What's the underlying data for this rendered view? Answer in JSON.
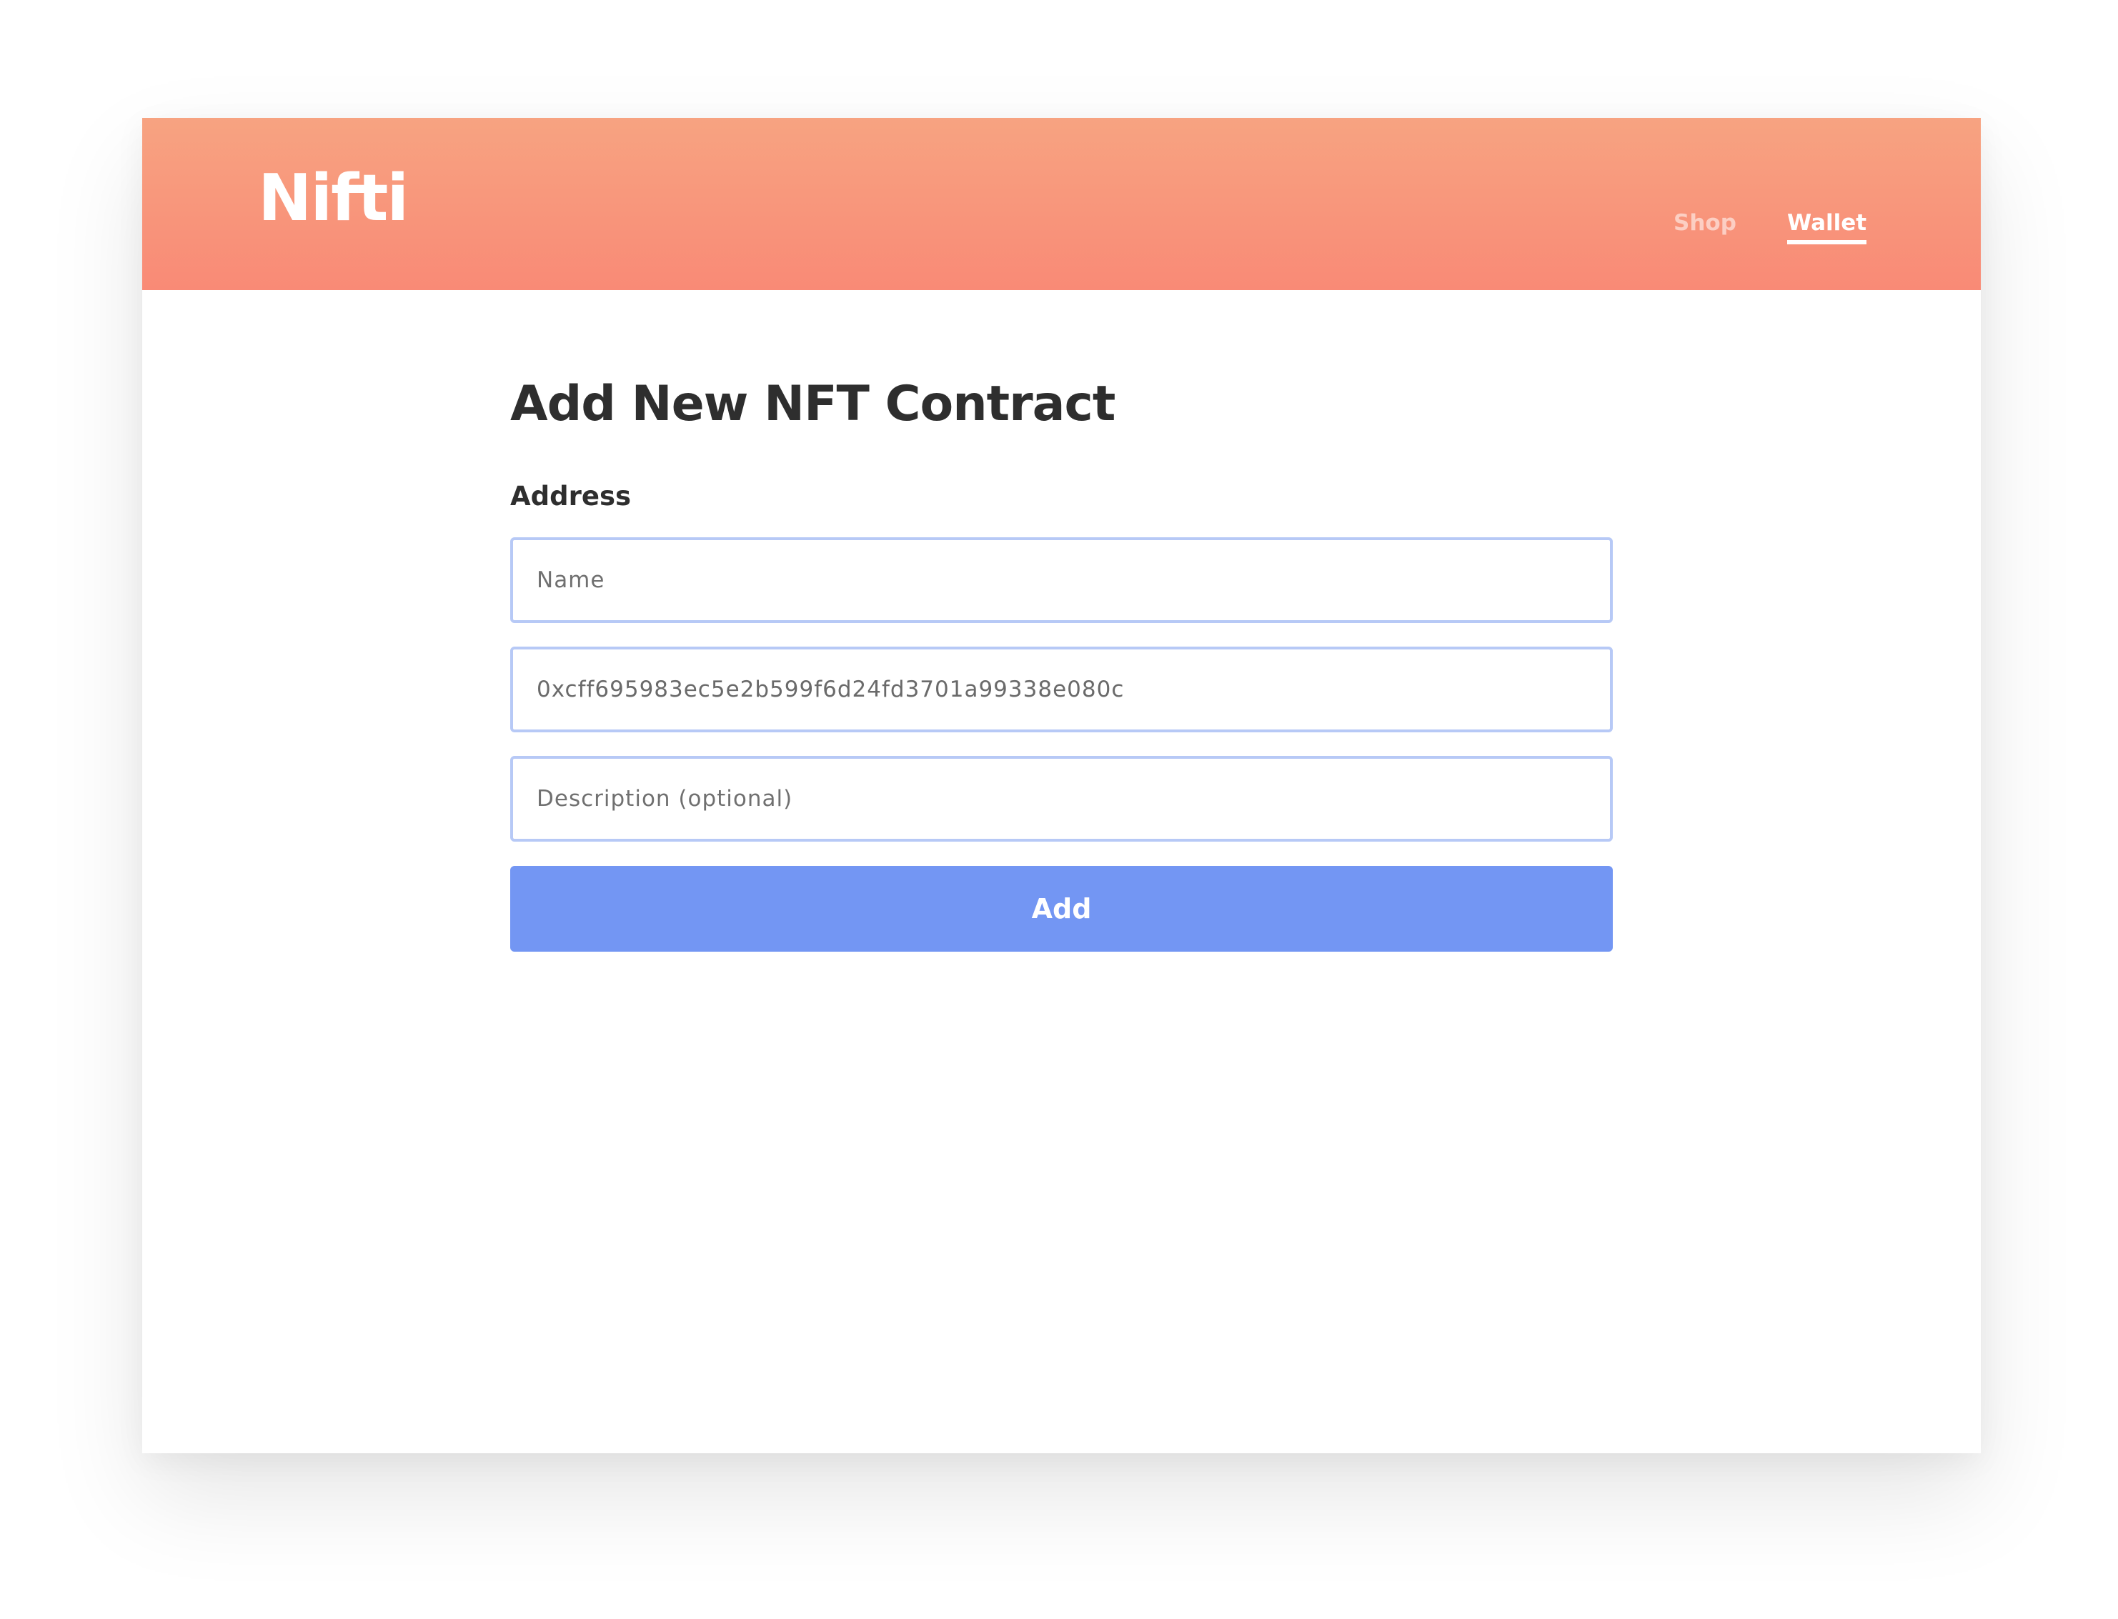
{
  "app": {
    "logo": "Nifti"
  },
  "nav": {
    "items": [
      {
        "label": "Shop",
        "active": false
      },
      {
        "label": "Wallet",
        "active": true
      }
    ]
  },
  "form": {
    "title": "Add New NFT Contract",
    "section_label": "Address",
    "name_field": {
      "placeholder": "Name",
      "value": ""
    },
    "address_field": {
      "placeholder": "",
      "value": "0xcff695983ec5e2b599f6d24fd3701a99338e080c"
    },
    "description_field": {
      "placeholder": "Description (optional)",
      "value": ""
    },
    "submit_label": "Add"
  },
  "colors": {
    "header_gradient_top": "#f7a381",
    "header_gradient_bottom": "#f98a76",
    "primary_button": "#7396f3",
    "input_border": "#b7c9f6",
    "text_dark": "#2e2e2e"
  }
}
